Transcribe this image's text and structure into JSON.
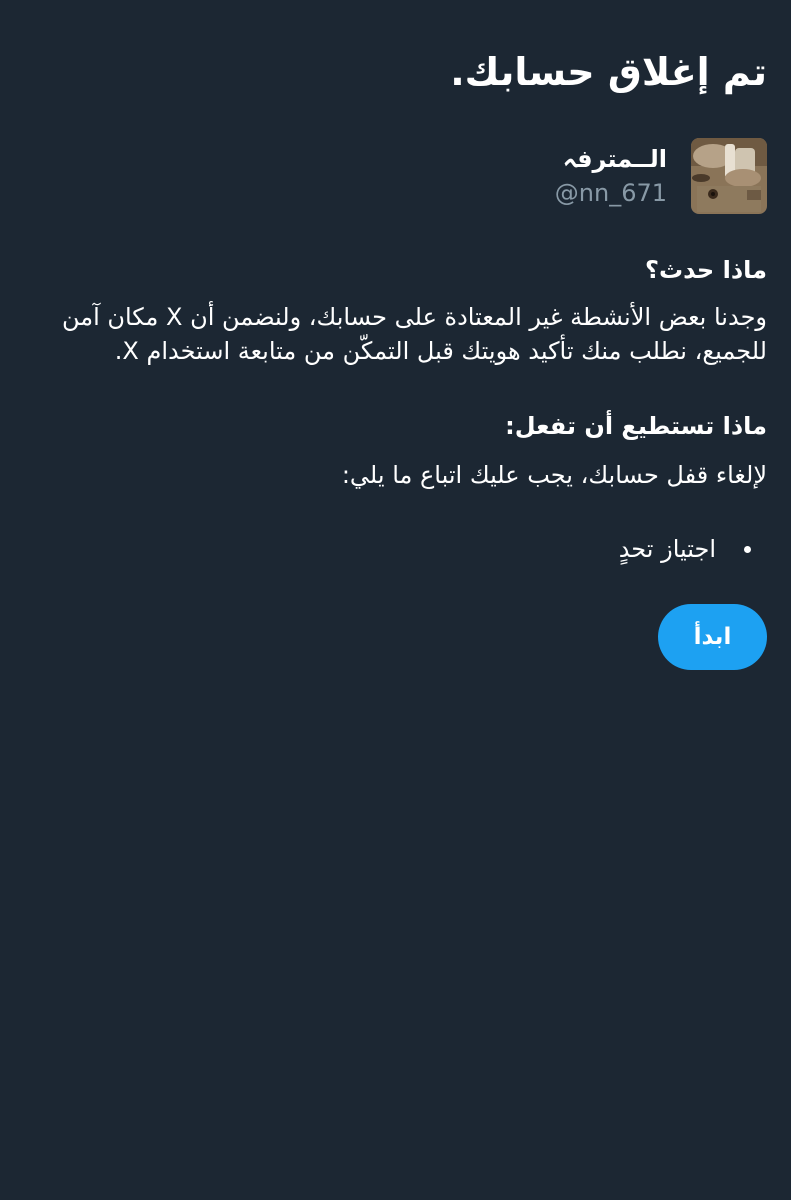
{
  "header": {
    "title": "تم إغلاق حسابك."
  },
  "profile": {
    "display_name": "الــمترفہ",
    "handle": "@nn_671",
    "avatar_icon": "profile-photo"
  },
  "what_happened": {
    "heading": "ماذا حدث؟",
    "body_lines": [
      "وجدنا بعض الأنشطة غير المعتادة على حسابك، ولنضمن أن X مكان آمن",
      "للجميع، نطلب منك تأكيد هويتك قبل التمكّن من متابعة استخدام X."
    ]
  },
  "what_you_can_do": {
    "heading": "ماذا تستطيع أن تفعل:",
    "instruction": "لإلغاء قفل حسابك، يجب عليك اتباع ما يلي:",
    "steps": [
      "اجتياز تحدٍ"
    ]
  },
  "actions": {
    "start_label": "ابدأ"
  },
  "colors": {
    "background": "#1c2733",
    "text": "#ffffff",
    "secondary_text": "#8899a6",
    "accent": "#1da1f2"
  }
}
